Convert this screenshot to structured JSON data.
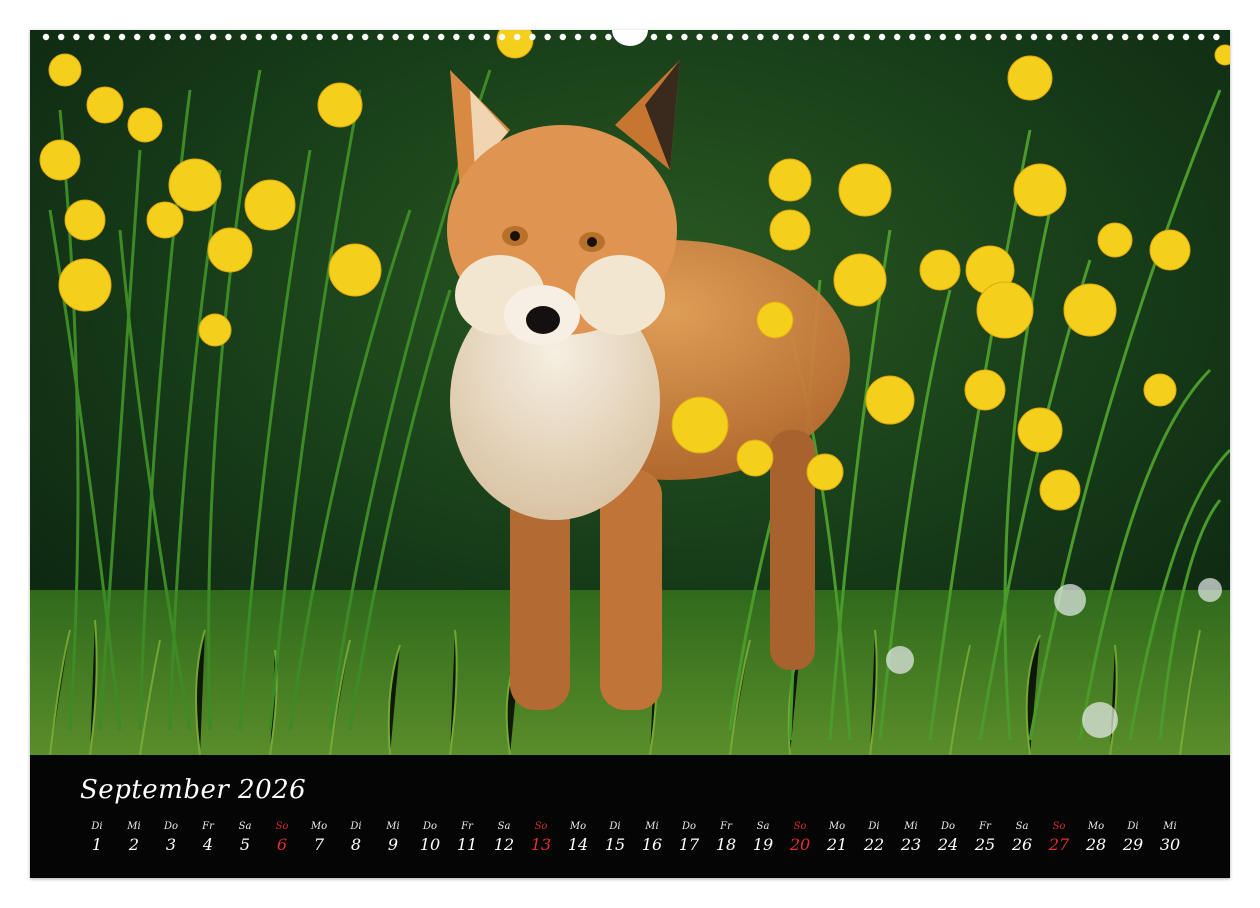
{
  "calendar": {
    "month_title": "September 2026",
    "colors": {
      "sunday": "#e0322e",
      "text": "#ffffff",
      "strip": "#050505"
    },
    "days": [
      {
        "wd": "Di",
        "num": "1"
      },
      {
        "wd": "Mi",
        "num": "2"
      },
      {
        "wd": "Do",
        "num": "3"
      },
      {
        "wd": "Fr",
        "num": "4"
      },
      {
        "wd": "Sa",
        "num": "5"
      },
      {
        "wd": "So",
        "num": "6",
        "sunday": true
      },
      {
        "wd": "Mo",
        "num": "7"
      },
      {
        "wd": "Di",
        "num": "8"
      },
      {
        "wd": "Mi",
        "num": "9"
      },
      {
        "wd": "Do",
        "num": "10"
      },
      {
        "wd": "Fr",
        "num": "11"
      },
      {
        "wd": "Sa",
        "num": "12"
      },
      {
        "wd": "So",
        "num": "13",
        "sunday": true
      },
      {
        "wd": "Mo",
        "num": "14"
      },
      {
        "wd": "Di",
        "num": "15"
      },
      {
        "wd": "Mi",
        "num": "16"
      },
      {
        "wd": "Do",
        "num": "17"
      },
      {
        "wd": "Fr",
        "num": "18"
      },
      {
        "wd": "Sa",
        "num": "19"
      },
      {
        "wd": "So",
        "num": "20",
        "sunday": true
      },
      {
        "wd": "Mo",
        "num": "21"
      },
      {
        "wd": "Di",
        "num": "22"
      },
      {
        "wd": "Mi",
        "num": "23"
      },
      {
        "wd": "Do",
        "num": "24"
      },
      {
        "wd": "Fr",
        "num": "25"
      },
      {
        "wd": "Sa",
        "num": "26"
      },
      {
        "wd": "So",
        "num": "27",
        "sunday": true
      },
      {
        "wd": "Mo",
        "num": "28"
      },
      {
        "wd": "Di",
        "num": "29"
      },
      {
        "wd": "Mi",
        "num": "30"
      }
    ]
  },
  "photo": {
    "subject": "fox-cub-icon",
    "colors": {
      "background": "#15331a",
      "grass": "#3f7a22",
      "grass_light": "#7fb13a",
      "dandelion": "#f4cf1c",
      "fox_fur": "#d98b45",
      "fox_light": "#efe2cd"
    }
  }
}
